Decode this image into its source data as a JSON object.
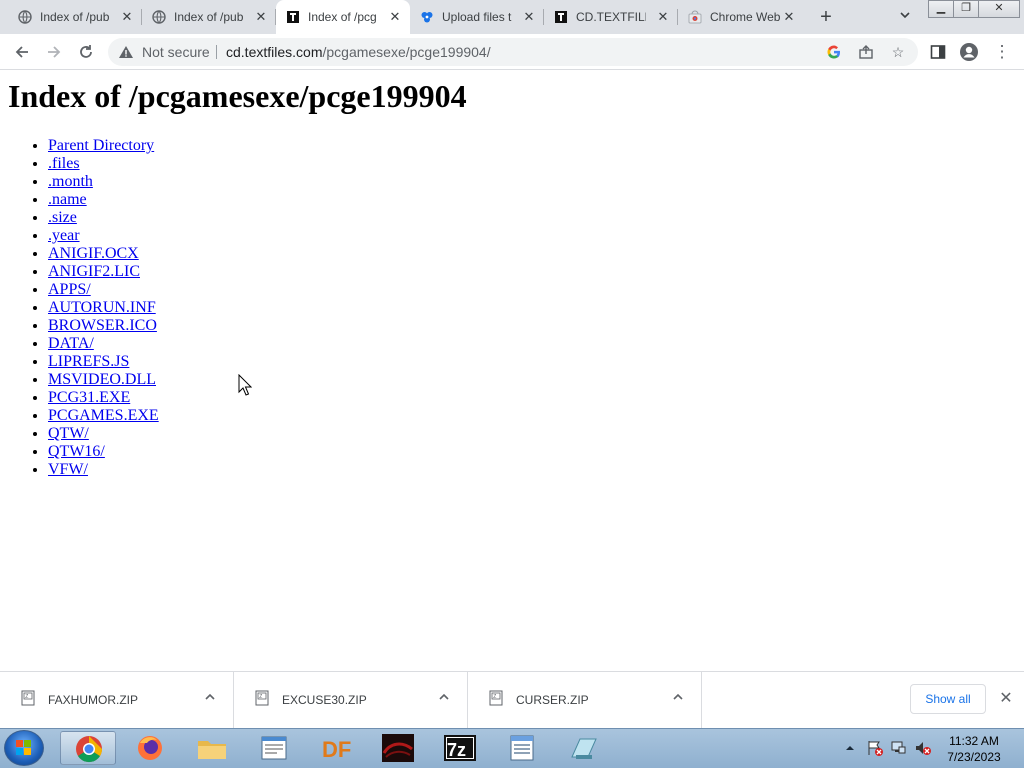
{
  "tabs": [
    {
      "title": "Index of /pub",
      "active": false,
      "icon": "globe-icon"
    },
    {
      "title": "Index of /pub",
      "active": false,
      "icon": "globe-icon"
    },
    {
      "title": "Index of /pcg",
      "active": true,
      "icon": "textfiles-icon"
    },
    {
      "title": "Upload files t",
      "active": false,
      "icon": "archive-icon"
    },
    {
      "title": "CD.TEXTFILES",
      "active": false,
      "icon": "textfiles-icon"
    },
    {
      "title": "Chrome Web",
      "active": false,
      "icon": "webstore-icon"
    }
  ],
  "omnibox": {
    "security": "Not secure",
    "url_host": "cd.textfiles.com",
    "url_path": "/pcgamesexe/pcge199904/"
  },
  "page": {
    "heading": "Index of /pcgamesexe/pcge199904",
    "links": [
      "Parent Directory",
      ".files",
      ".month",
      ".name",
      ".size",
      ".year",
      "ANIGIF.OCX",
      "ANIGIF2.LIC",
      "APPS/",
      "AUTORUN.INF",
      "BROWSER.ICO",
      "DATA/",
      "LIPREFS.JS",
      "MSVIDEO.DLL",
      "PCG31.EXE",
      "PCGAMES.EXE",
      "QTW/",
      "QTW16/",
      "VFW/"
    ]
  },
  "downloads": {
    "items": [
      "FAXHUMOR.ZIP",
      "EXCUSE30.ZIP",
      "CURSER.ZIP"
    ],
    "show_all": "Show all"
  },
  "taskbar": {
    "apps": [
      "chrome-icon",
      "firefox-icon",
      "file-explorer-icon",
      "notepad-icon",
      "df-icon",
      "game-icon",
      "7zip-icon",
      "wordpad-icon",
      "paint-icon"
    ],
    "df_label": "DF",
    "sevenzip_label": "7z",
    "time": "11:32 AM",
    "date": "7/23/2023"
  },
  "colors": {
    "link": "#0000ee",
    "accent": "#1a73e8",
    "tabstrip": "#dee1e6"
  }
}
